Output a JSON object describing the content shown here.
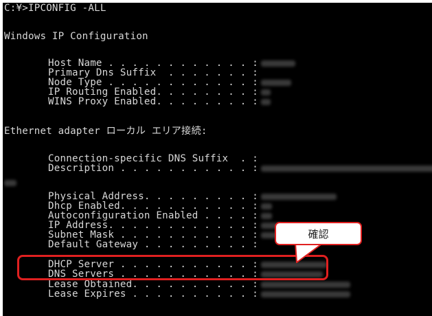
{
  "prompt_line": "C:¥>IPCONFIG -ALL",
  "header": "Windows IP Configuration",
  "ip_config": [
    {
      "label": "Host Name . . . . . . . . . . . . :"
    },
    {
      "label": "Primary Dns Suffix  . . . . . . . :"
    },
    {
      "label": "Node Type . . . . . . . . . . . . :"
    },
    {
      "label": "IP Routing Enabled. . . . . . . . :"
    },
    {
      "label": "WINS Proxy Enabled. . . . . . . . :"
    }
  ],
  "adapter_header": "Ethernet adapter ローカル エリア接続:",
  "adapter_rows": [
    {
      "label": "Connection-specific DNS Suffix  . :"
    },
    {
      "label": "Description . . . . . . . . . . . :"
    },
    {
      "label": "Physical Address. . . . . . . . . :"
    },
    {
      "label": "Dhcp Enabled. . . . . . . . . . . :"
    },
    {
      "label": "Autoconfiguration Enabled . . . . :"
    },
    {
      "label": "IP Address. . . . . . . . . . . . :"
    },
    {
      "label": "Subnet Mask . . . . . . . . . . . :"
    },
    {
      "label": "Default Gateway . . . . . . . . . :"
    },
    {
      "label": "DHCP Server . . . . . . . . . . . :"
    },
    {
      "label": "DNS Servers . . . . . . . . . . . :"
    },
    {
      "label": "Lease Obtained. . . . . . . . . . :"
    },
    {
      "label": "Lease Expires . . . . . . . . . . :"
    }
  ],
  "callout": {
    "text": "確認",
    "border_color": "#e02020"
  }
}
